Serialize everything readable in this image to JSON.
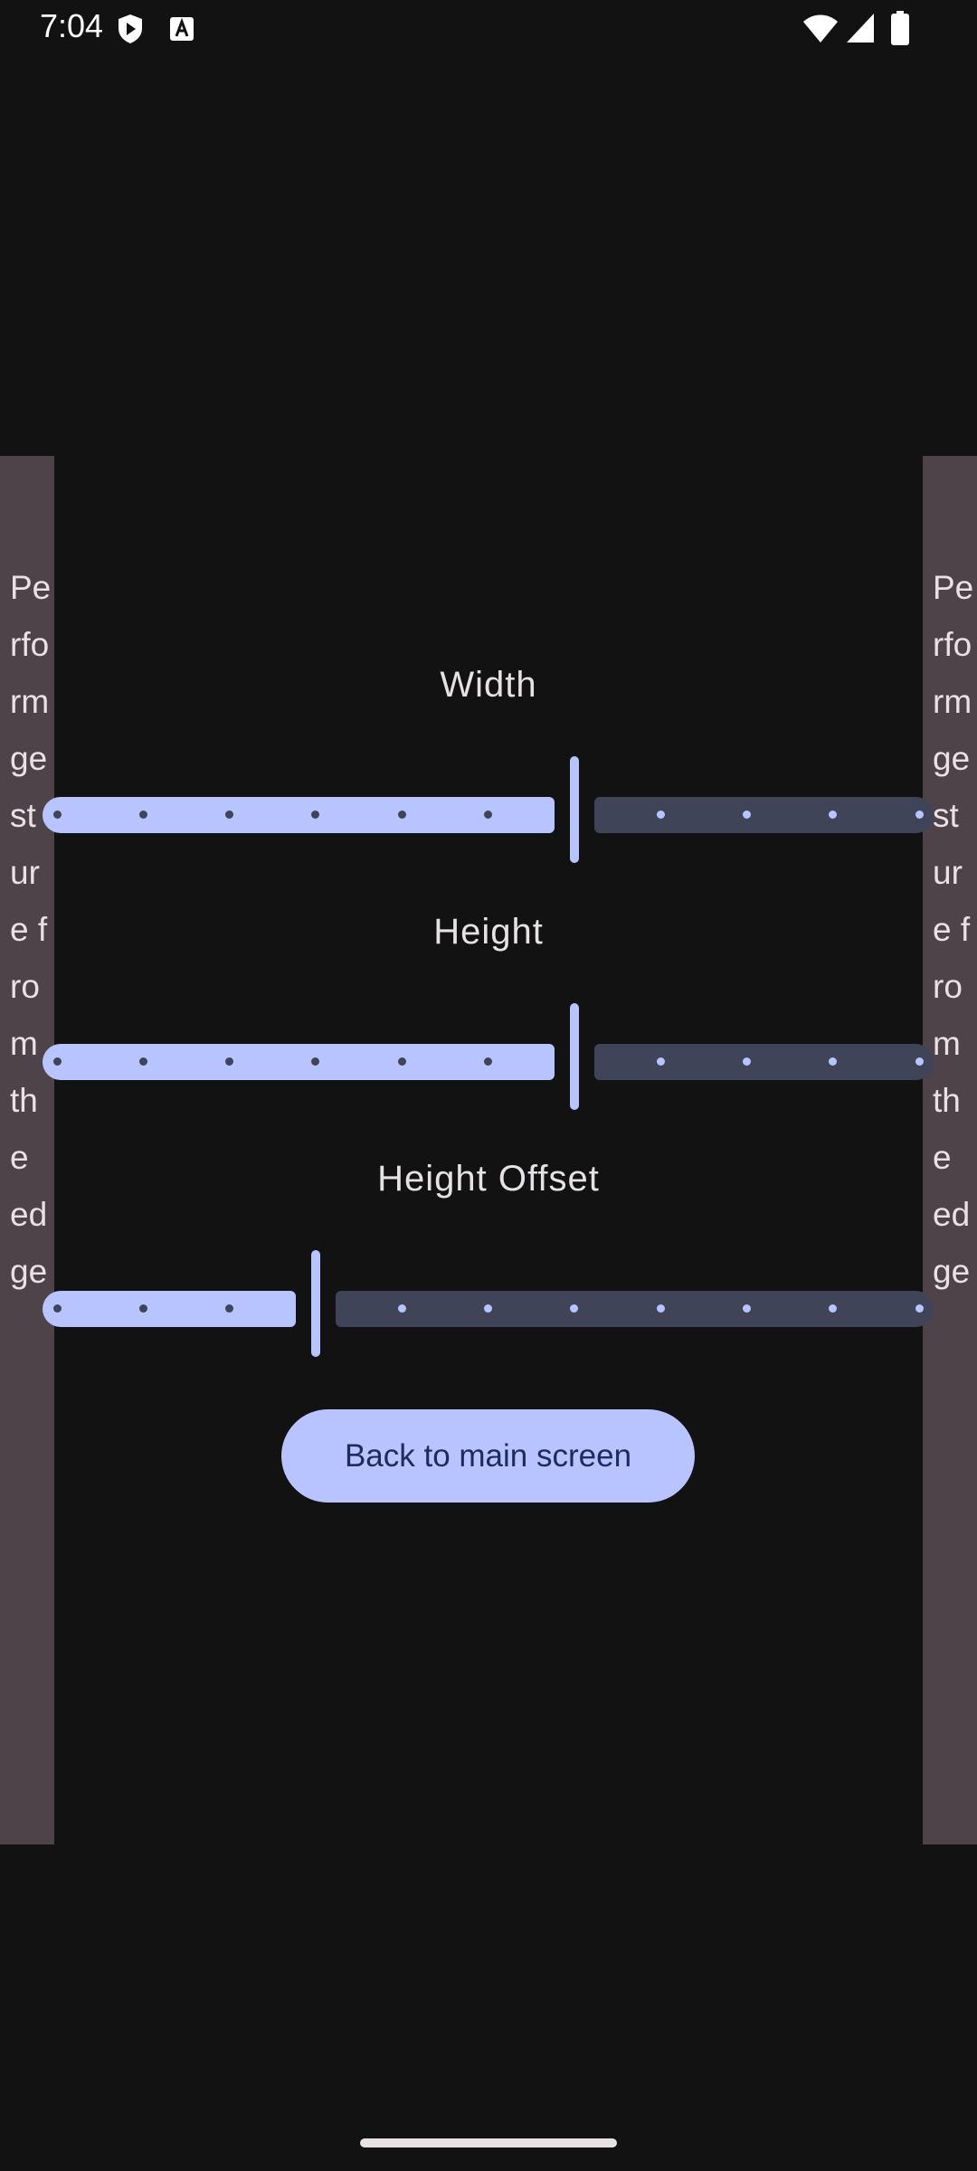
{
  "status_bar": {
    "time": "7:04",
    "left_icons": [
      "play-shield-icon",
      "keyboard-a-icon"
    ],
    "right_icons": [
      "wifi-icon",
      "cell-signal-icon",
      "battery-icon"
    ]
  },
  "edge_panels": {
    "left_text": "Perform gesture from the edge",
    "right_text": "Perform gesture from the edge"
  },
  "sliders": [
    {
      "label": "Width",
      "value": 6,
      "steps": 10
    },
    {
      "label": "Height",
      "value": 6,
      "steps": 10
    },
    {
      "label": "Height Offset",
      "value": 3,
      "steps": 10
    }
  ],
  "back_button": {
    "label": "Back to main screen"
  },
  "colors": {
    "accent": "#b7c4ff",
    "track_inactive": "#3f4459",
    "edge_panel": "#4d4349",
    "background": "#121212"
  }
}
